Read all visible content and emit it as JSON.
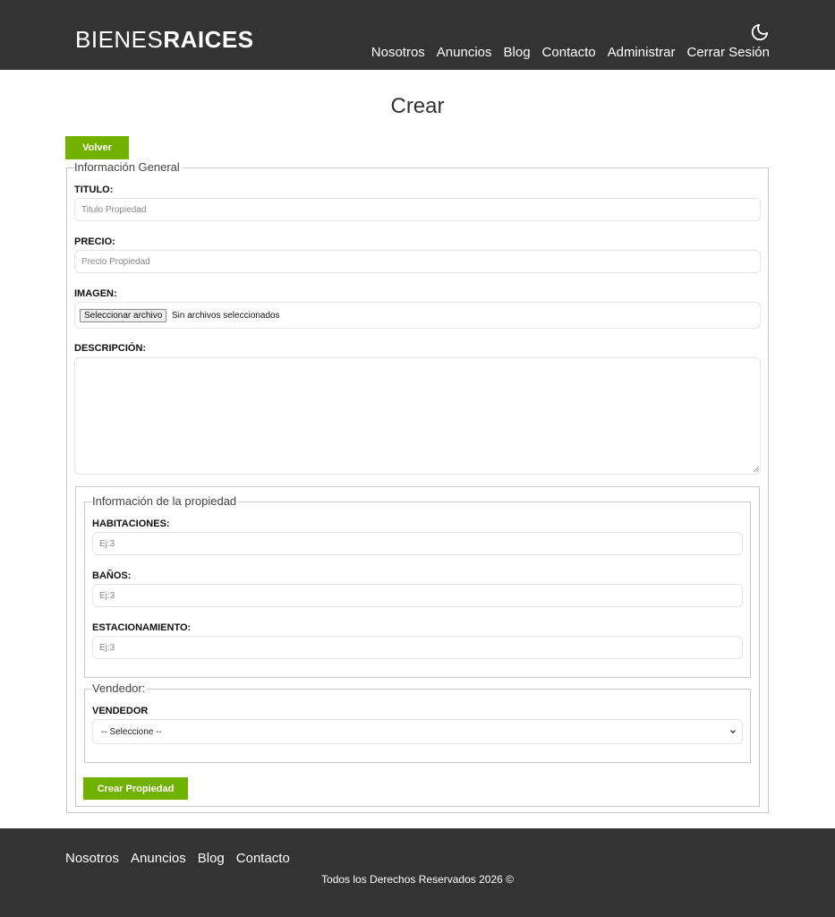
{
  "header": {
    "logo_light": "BIENES",
    "logo_bold": "RAICES",
    "nav": [
      "Nosotros",
      "Anuncios",
      "Blog",
      "Contacto",
      "Administrar",
      "Cerrar Sesión"
    ],
    "theme_icon": "moon-icon"
  },
  "page": {
    "title": "Crear",
    "back_label": "Volver"
  },
  "form": {
    "general_legend": "Información General",
    "titulo_label": "TITULO:",
    "titulo_placeholder": "Titulo Propiedad",
    "precio_label": "PRECIO:",
    "precio_placeholder": "Precio Propiedad",
    "imagen_label": "IMAGEN:",
    "file_button": "Seleccionar archivo",
    "file_status": "Sin archivos seleccionados",
    "descripcion_label": "DESCRIPCIÓN:",
    "descripcion_value": "",
    "propiedad_legend": "Información de la propiedad",
    "habitaciones_label": "HABITACIONES:",
    "habitaciones_placeholder": "Ej:3",
    "banos_label": "BAÑOS:",
    "banos_placeholder": "Ej:3",
    "estacionamiento_label": "ESTACIONAMIENTO:",
    "estacionamiento_placeholder": "Ej:3",
    "vendedor_legend": "Vendedor:",
    "vendedor_label": "VENDEDOR",
    "vendedor_selected": "-- Seleccione --",
    "submit_label": "Crear Propiedad"
  },
  "footer": {
    "nav": [
      "Nosotros",
      "Anuncios",
      "Blog",
      "Contacto"
    ],
    "copyright": "Todos los Derechos Reservados 2026 ©"
  },
  "colors": {
    "header_bg": "#333333",
    "accent_green": "#71b100",
    "border": "#c8c8c8"
  }
}
